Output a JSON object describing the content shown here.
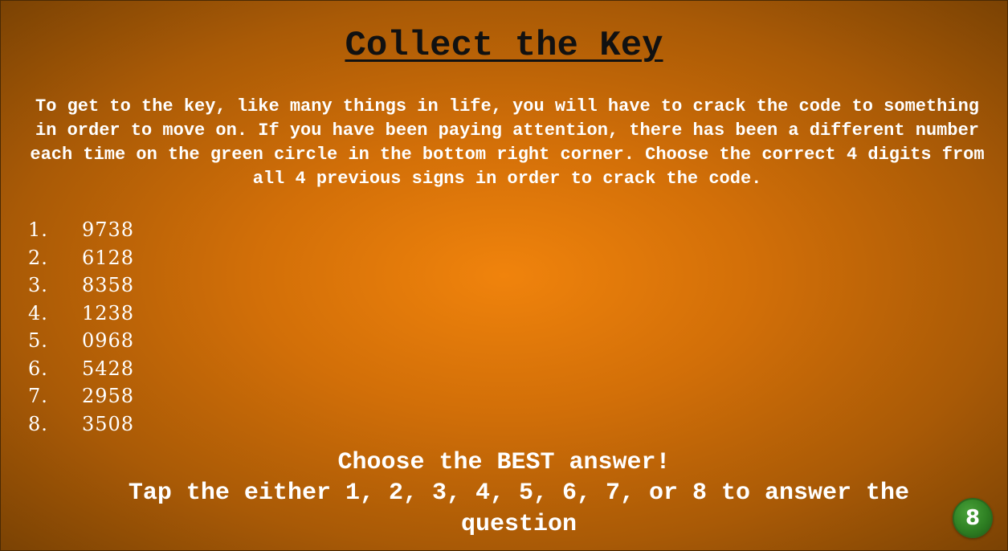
{
  "title": "Collect the Key",
  "intro": "To get to the key, like many things in life, you will have to crack the code to something in order to move on. If you have been paying attention, there has been a different number each time on the green circle in the bottom right corner. Choose the correct 4 digits from all 4 previous signs in order to crack the code.",
  "options": [
    {
      "number": "1.",
      "value": "9738"
    },
    {
      "number": "2.",
      "value": "6128"
    },
    {
      "number": "3.",
      "value": "8358"
    },
    {
      "number": "4.",
      "value": "1238"
    },
    {
      "number": "5.",
      "value": "0968"
    },
    {
      "number": "6.",
      "value": "5428"
    },
    {
      "number": "7.",
      "value": "2958"
    },
    {
      "number": "8.",
      "value": "3508"
    }
  ],
  "prompt": "Choose the BEST answer!",
  "instruction": "Tap the either 1, 2, 3, 4, 5, 6, 7, or 8 to answer the question",
  "page_badge": {
    "number": "8",
    "color": "#2e8023"
  },
  "colors": {
    "background_center": "#f0830c",
    "background_edge": "#7a4204",
    "title": "#111111",
    "text": "#ffffff"
  }
}
